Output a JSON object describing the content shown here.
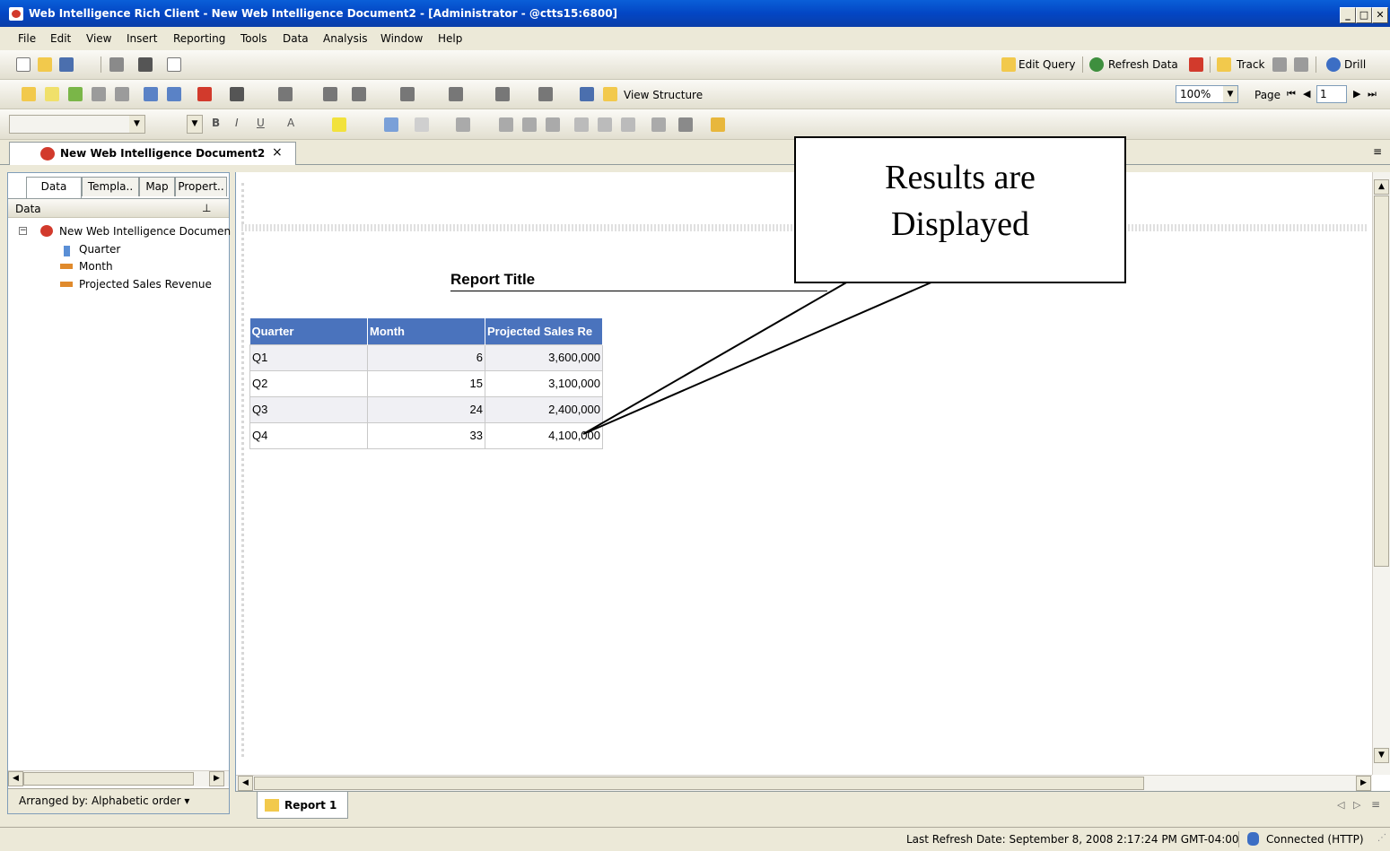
{
  "window": {
    "title": "Web Intelligence Rich Client - New Web Intelligence Document2 - [Administrator - @ctts15:6800]",
    "minimize": "_",
    "maximize": "□",
    "close": "✕"
  },
  "menu": [
    "File",
    "Edit",
    "View",
    "Insert",
    "Reporting",
    "Tools",
    "Data",
    "Analysis",
    "Window",
    "Help"
  ],
  "toolbar_right": {
    "edit_query": "Edit Query",
    "refresh_data": "Refresh Data",
    "track": "Track",
    "drill": "Drill"
  },
  "toolbar2": {
    "view_structure": "View Structure",
    "zoom": "100%",
    "page_label": "Page",
    "page_value": "1"
  },
  "doc_tab": {
    "label": "New Web Intelligence Document2",
    "close": "×"
  },
  "left_panel": {
    "tabs": [
      "Data",
      "Templa..",
      "Map",
      "Propert.."
    ],
    "header": "Data",
    "pin": "⊥",
    "tree": {
      "root": "New Web Intelligence Documen",
      "items": [
        "Quarter",
        "Month",
        "Projected Sales Revenue"
      ]
    },
    "arranged_by": "Arranged by: Alphabetic order ▾"
  },
  "report": {
    "title": "Report Title",
    "columns": [
      "Quarter",
      "Month",
      "Projected Sales Re"
    ],
    "rows": [
      [
        "Q1",
        "6",
        "3,600,000"
      ],
      [
        "Q2",
        "15",
        "3,100,000"
      ],
      [
        "Q3",
        "24",
        "2,400,000"
      ],
      [
        "Q4",
        "33",
        "4,100,000"
      ]
    ],
    "tab": "Report 1"
  },
  "callout": {
    "line1": "Results are",
    "line2": "Displayed"
  },
  "status": {
    "last_refresh": "Last Refresh Date: September 8, 2008 2:17:24 PM GMT-04:00",
    "connection": "Connected (HTTP)"
  }
}
